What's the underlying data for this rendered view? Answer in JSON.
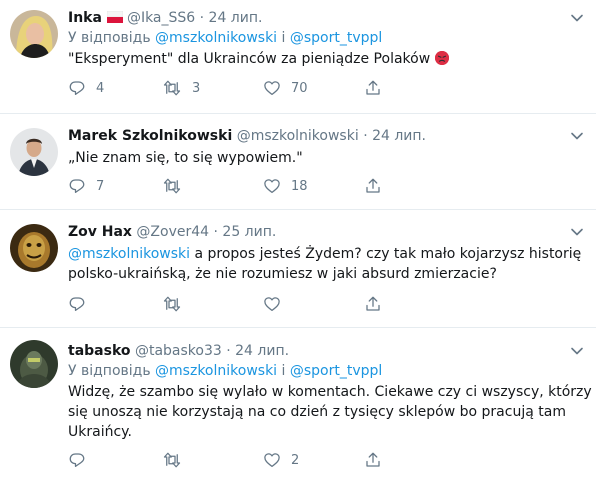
{
  "tweets": [
    {
      "name": "Inka",
      "handle": "@Ika_SS6",
      "dot": "·",
      "time": "24 лип.",
      "reply_prefix": "У відповідь",
      "reply_user1": "@mszkolnikowski",
      "reply_and": "і",
      "reply_user2": "@sport_tvppl",
      "text": "\"Eksperyment\" dla Ukrainców za pieniądze Polaków",
      "replies": "4",
      "retweets": "3",
      "likes": "70"
    },
    {
      "name": "Marek Szkolnikowski",
      "handle": "@mszkolnikowski",
      "dot": "·",
      "time": "24 лип.",
      "text": "„Nie znam się, to się wypowiem.\"",
      "replies": "7",
      "retweets": "",
      "likes": "18"
    },
    {
      "name": "Zov Hax",
      "handle": "@Zover44",
      "dot": "·",
      "time": "25 лип.",
      "mention": "@mszkolnikowski",
      "text_line1": " a propos jesteś Żydem? czy tak mało kojarzysz historię",
      "text_line2": "polsko-ukraińską, że nie rozumiesz w jaki absurd zmierzacie?",
      "replies": "",
      "retweets": "",
      "likes": ""
    },
    {
      "name": "tabasko",
      "handle": "@tabasko33",
      "dot": "·",
      "time": "24 лип.",
      "reply_prefix": "У відповідь",
      "reply_user1": "@mszkolnikowski",
      "reply_and": "і",
      "reply_user2": "@sport_tvppl",
      "text_line1": "Widzę, że szambo się wylało w komentach. Ciekawe czy ci wszyscy, którzy tak",
      "text_line2": "się unoszą nie korzystają na co dzień z tysięcy sklepów bo pracują tam",
      "text_line3": "Ukraińcy.",
      "replies": "",
      "retweets": "",
      "likes": "2"
    }
  ],
  "icons": {
    "reply": "reply-icon",
    "retweet": "retweet-icon",
    "like": "heart-icon",
    "share": "share-icon",
    "more": "chevron-down-icon",
    "flag": "poland-flag-icon",
    "emoji": "angry-face-emoji"
  },
  "colors": {
    "link": "#1b95e0",
    "secondary": "#657786",
    "text": "#14171a",
    "divider": "#e6ecf0"
  }
}
